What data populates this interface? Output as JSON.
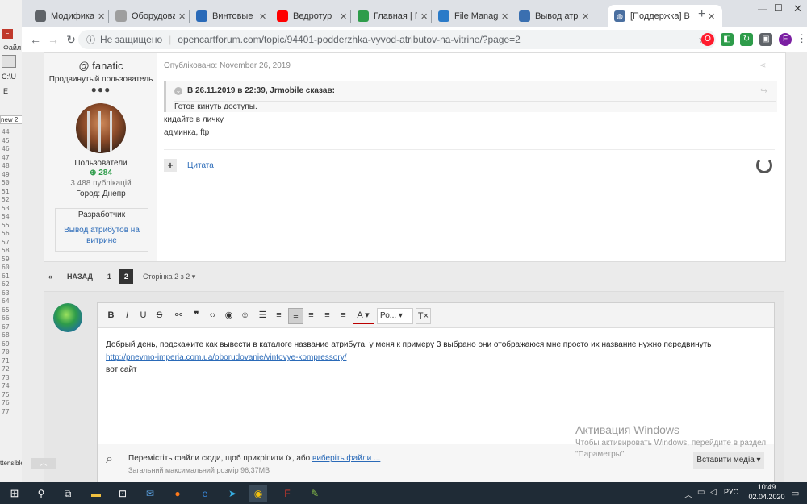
{
  "bg_app": {
    "menu_top": "Файл",
    "path": "C:\\U",
    "edit": "E",
    "tab": "new 2",
    "line_numbers": [
      "44",
      "45",
      "46",
      "47",
      "48",
      "49",
      "50",
      "51",
      "52",
      "53",
      "54",
      "55",
      "56",
      "57",
      "58",
      "59",
      "60",
      "61",
      "62",
      "63",
      "64",
      "65",
      "66",
      "67",
      "68",
      "69",
      "70",
      "71",
      "72",
      "73",
      "74",
      "75",
      "76",
      "77"
    ],
    "status": "ttensible"
  },
  "browser": {
    "tabs": [
      {
        "title": "Модификаторы",
        "color": "#5f6368",
        "icon": "gear-icon"
      },
      {
        "title": "Оборудование",
        "color": "#9e9e9e",
        "icon": "cart-icon"
      },
      {
        "title": "Винтовые комп",
        "color": "#2a6ab8",
        "icon": "loading-icon"
      },
      {
        "title": "Ведротур",
        "color": "#ff0000",
        "icon": "youtube-icon"
      },
      {
        "title": "Главная | Пане",
        "color": "#2e9c4a",
        "icon": "site-icon"
      },
      {
        "title": "File Manager -",
        "color": "#2a7ac8",
        "icon": "file-manager-icon"
      },
      {
        "title": "Вывод атрибут",
        "color": "#3a6fb0",
        "icon": "globe-icon"
      },
      {
        "title": "[Поддержка] В",
        "color": "#4a6fa0",
        "icon": "globe-icon"
      }
    ],
    "not_secure": "Не защищено",
    "url": "opencartforum.com/topic/94401-podderzhka-vyvod-atributov-na-vitrine/?page=2",
    "profile_letter": "F",
    "colors": {
      "opera": "#ff1b2d",
      "green_ext": "#2e9c4a",
      "bookmark": "#5f6368",
      "profile": "#7b1fa2"
    }
  },
  "post": {
    "author": "@ fanatic",
    "rank": "Продвинутый пользователь",
    "group": "Пользователи",
    "reputation": "284",
    "publications": "3 488 публікацій",
    "city": "Город: Днепр",
    "badge_title": "Разработчик",
    "badge_text": "Вывод атрибутов на витрине",
    "published": "Опубліковано: November 26, 2019",
    "quote_header": "В 26.11.2019 в 22:39, Jrmobile сказав:",
    "quote_text": "Готов кинуть доступы.",
    "line1": "кидайте в личку",
    "line2": "админка, ftp",
    "quote_button": "Цитата"
  },
  "pagination": {
    "prev": "НАЗАД",
    "pages": [
      "1",
      "2"
    ],
    "current": "2",
    "page_of": "Сторінка 2 з 2"
  },
  "editor": {
    "font_label": "Ро...",
    "line1": "Добрый день, подскажите как вывести в каталоге название атрибута, у меня к примеру 3 выбрано они отображаюся мне просто их название нужно передвинуть",
    "link": "http://pnevmo-imperia.com.ua/oborudovanie/vintovye-kompressory/",
    "line3": "вот сайт",
    "attach_text": "Перемістіть файли сюди, щоб прикріпити їх, або",
    "attach_link": "виберіть файли ...",
    "max_size": "Загальний максимальний розмір 96,37MB",
    "insert_media": "Вставити медіа"
  },
  "watermark": {
    "title": "Активация Windows",
    "text": "Чтобы активировать Windows, перейдите в раздел \"Параметры\"."
  },
  "taskbar": {
    "lang": "РУС",
    "time": "10:49",
    "date": "02.04.2020"
  }
}
